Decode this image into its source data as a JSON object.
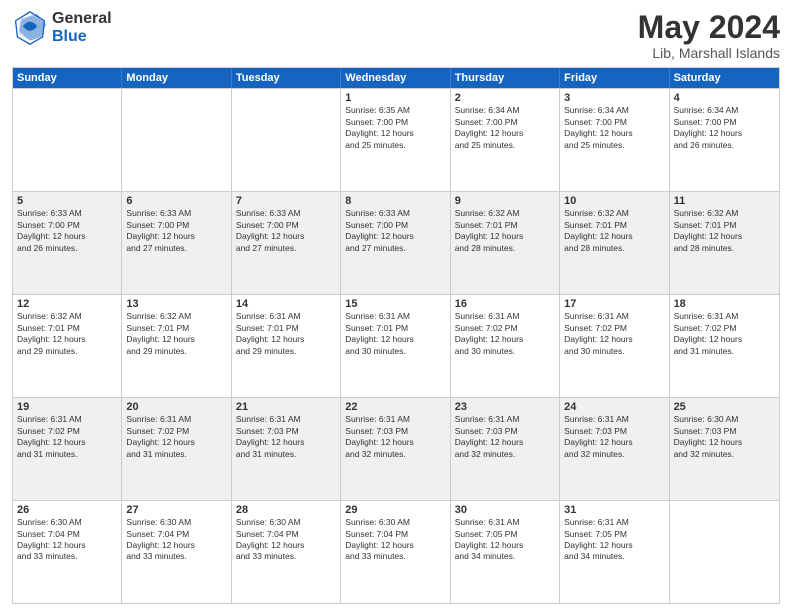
{
  "logo": {
    "general": "General",
    "blue": "Blue"
  },
  "title": "May 2024",
  "location": "Lib, Marshall Islands",
  "days_of_week": [
    "Sunday",
    "Monday",
    "Tuesday",
    "Wednesday",
    "Thursday",
    "Friday",
    "Saturday"
  ],
  "weeks": [
    [
      {
        "day": "",
        "info": ""
      },
      {
        "day": "",
        "info": ""
      },
      {
        "day": "",
        "info": ""
      },
      {
        "day": "1",
        "info": "Sunrise: 6:35 AM\nSunset: 7:00 PM\nDaylight: 12 hours\nand 25 minutes."
      },
      {
        "day": "2",
        "info": "Sunrise: 6:34 AM\nSunset: 7:00 PM\nDaylight: 12 hours\nand 25 minutes."
      },
      {
        "day": "3",
        "info": "Sunrise: 6:34 AM\nSunset: 7:00 PM\nDaylight: 12 hours\nand 25 minutes."
      },
      {
        "day": "4",
        "info": "Sunrise: 6:34 AM\nSunset: 7:00 PM\nDaylight: 12 hours\nand 26 minutes."
      }
    ],
    [
      {
        "day": "5",
        "info": "Sunrise: 6:33 AM\nSunset: 7:00 PM\nDaylight: 12 hours\nand 26 minutes."
      },
      {
        "day": "6",
        "info": "Sunrise: 6:33 AM\nSunset: 7:00 PM\nDaylight: 12 hours\nand 27 minutes."
      },
      {
        "day": "7",
        "info": "Sunrise: 6:33 AM\nSunset: 7:00 PM\nDaylight: 12 hours\nand 27 minutes."
      },
      {
        "day": "8",
        "info": "Sunrise: 6:33 AM\nSunset: 7:00 PM\nDaylight: 12 hours\nand 27 minutes."
      },
      {
        "day": "9",
        "info": "Sunrise: 6:32 AM\nSunset: 7:01 PM\nDaylight: 12 hours\nand 28 minutes."
      },
      {
        "day": "10",
        "info": "Sunrise: 6:32 AM\nSunset: 7:01 PM\nDaylight: 12 hours\nand 28 minutes."
      },
      {
        "day": "11",
        "info": "Sunrise: 6:32 AM\nSunset: 7:01 PM\nDaylight: 12 hours\nand 28 minutes."
      }
    ],
    [
      {
        "day": "12",
        "info": "Sunrise: 6:32 AM\nSunset: 7:01 PM\nDaylight: 12 hours\nand 29 minutes."
      },
      {
        "day": "13",
        "info": "Sunrise: 6:32 AM\nSunset: 7:01 PM\nDaylight: 12 hours\nand 29 minutes."
      },
      {
        "day": "14",
        "info": "Sunrise: 6:31 AM\nSunset: 7:01 PM\nDaylight: 12 hours\nand 29 minutes."
      },
      {
        "day": "15",
        "info": "Sunrise: 6:31 AM\nSunset: 7:01 PM\nDaylight: 12 hours\nand 30 minutes."
      },
      {
        "day": "16",
        "info": "Sunrise: 6:31 AM\nSunset: 7:02 PM\nDaylight: 12 hours\nand 30 minutes."
      },
      {
        "day": "17",
        "info": "Sunrise: 6:31 AM\nSunset: 7:02 PM\nDaylight: 12 hours\nand 30 minutes."
      },
      {
        "day": "18",
        "info": "Sunrise: 6:31 AM\nSunset: 7:02 PM\nDaylight: 12 hours\nand 31 minutes."
      }
    ],
    [
      {
        "day": "19",
        "info": "Sunrise: 6:31 AM\nSunset: 7:02 PM\nDaylight: 12 hours\nand 31 minutes."
      },
      {
        "day": "20",
        "info": "Sunrise: 6:31 AM\nSunset: 7:02 PM\nDaylight: 12 hours\nand 31 minutes."
      },
      {
        "day": "21",
        "info": "Sunrise: 6:31 AM\nSunset: 7:03 PM\nDaylight: 12 hours\nand 31 minutes."
      },
      {
        "day": "22",
        "info": "Sunrise: 6:31 AM\nSunset: 7:03 PM\nDaylight: 12 hours\nand 32 minutes."
      },
      {
        "day": "23",
        "info": "Sunrise: 6:31 AM\nSunset: 7:03 PM\nDaylight: 12 hours\nand 32 minutes."
      },
      {
        "day": "24",
        "info": "Sunrise: 6:31 AM\nSunset: 7:03 PM\nDaylight: 12 hours\nand 32 minutes."
      },
      {
        "day": "25",
        "info": "Sunrise: 6:30 AM\nSunset: 7:03 PM\nDaylight: 12 hours\nand 32 minutes."
      }
    ],
    [
      {
        "day": "26",
        "info": "Sunrise: 6:30 AM\nSunset: 7:04 PM\nDaylight: 12 hours\nand 33 minutes."
      },
      {
        "day": "27",
        "info": "Sunrise: 6:30 AM\nSunset: 7:04 PM\nDaylight: 12 hours\nand 33 minutes."
      },
      {
        "day": "28",
        "info": "Sunrise: 6:30 AM\nSunset: 7:04 PM\nDaylight: 12 hours\nand 33 minutes."
      },
      {
        "day": "29",
        "info": "Sunrise: 6:30 AM\nSunset: 7:04 PM\nDaylight: 12 hours\nand 33 minutes."
      },
      {
        "day": "30",
        "info": "Sunrise: 6:31 AM\nSunset: 7:05 PM\nDaylight: 12 hours\nand 34 minutes."
      },
      {
        "day": "31",
        "info": "Sunrise: 6:31 AM\nSunset: 7:05 PM\nDaylight: 12 hours\nand 34 minutes."
      },
      {
        "day": "",
        "info": ""
      }
    ]
  ]
}
